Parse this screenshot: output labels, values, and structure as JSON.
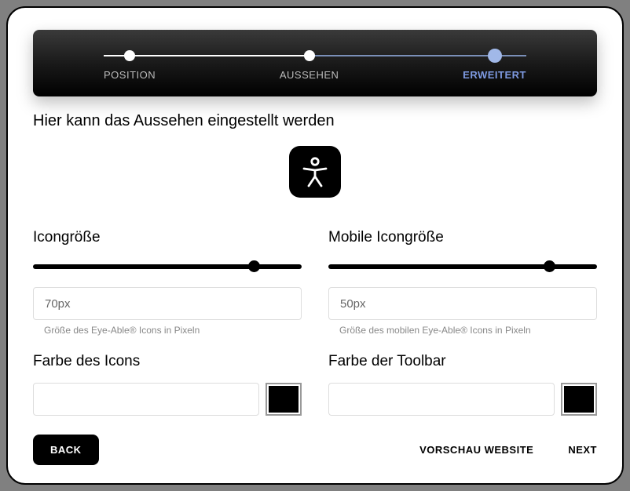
{
  "stepper": {
    "steps": [
      {
        "label": "POSITION",
        "active": false
      },
      {
        "label": "AUSSEHEN",
        "active": false
      },
      {
        "label": "ERWEITERT",
        "active": true
      }
    ]
  },
  "subtitle": "Hier kann das Aussehen eingestellt werden",
  "icon_preview": {
    "name": "accessibility-icon"
  },
  "fields": {
    "icon_size": {
      "label": "Icongröße",
      "value": "70px",
      "helper": "Größe des Eye-Able® Icons in Pixeln",
      "slider_pos_pct": 80
    },
    "mobile_icon_size": {
      "label": "Mobile Icongröße",
      "value": "50px",
      "helper": "Größe des mobilen Eye-Able® Icons in Pixeln",
      "slider_pos_pct": 80
    },
    "icon_color": {
      "label": "Farbe des Icons",
      "value": "",
      "swatch": "#000000"
    },
    "toolbar_color": {
      "label": "Farbe der Toolbar",
      "value": "",
      "swatch": "#000000"
    }
  },
  "footer": {
    "back": "BACK",
    "preview": "VORSCHAU WEBSITE",
    "next": "NEXT"
  }
}
